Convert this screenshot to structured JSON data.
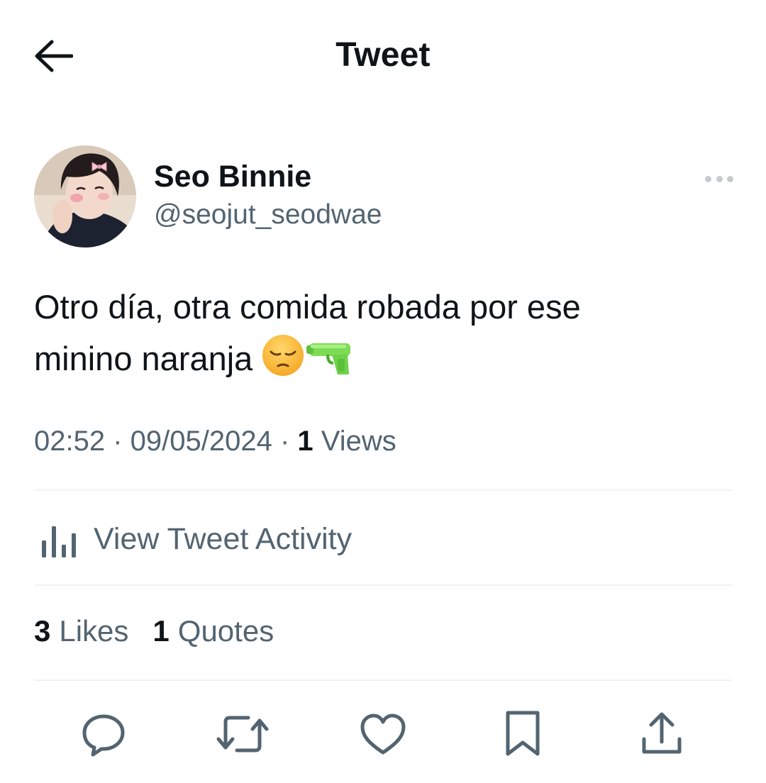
{
  "header": {
    "back_icon": "arrow-left-icon",
    "title": "Tweet"
  },
  "author": {
    "name": "Seo Binnie",
    "handle": "@seojut_seodwae",
    "more_icon": "more-horizontal-icon"
  },
  "tweet": {
    "text_line1": "Otro día, otra comida robada por ese",
    "text_line2": "minino naranja",
    "emojis": [
      "pensive-face-emoji",
      "water-pistol-emoji"
    ]
  },
  "meta": {
    "time": "02:52",
    "separator": " · ",
    "date": "09/05/2024",
    "views_count": "1",
    "views_label": "Views"
  },
  "activity": {
    "icon": "bar-chart-icon",
    "label": "View Tweet Activity"
  },
  "stats": {
    "likes_count": "3",
    "likes_label": "Likes",
    "quotes_count": "1",
    "quotes_label": "Quotes"
  },
  "actions": {
    "icons": [
      "reply-icon",
      "retweet-icon",
      "like-icon",
      "bookmark-icon",
      "share-icon"
    ]
  },
  "colors": {
    "text_primary": "#0f1419",
    "text_secondary": "#536471",
    "divider": "#eff3f4",
    "icon_gray": "#536471"
  }
}
